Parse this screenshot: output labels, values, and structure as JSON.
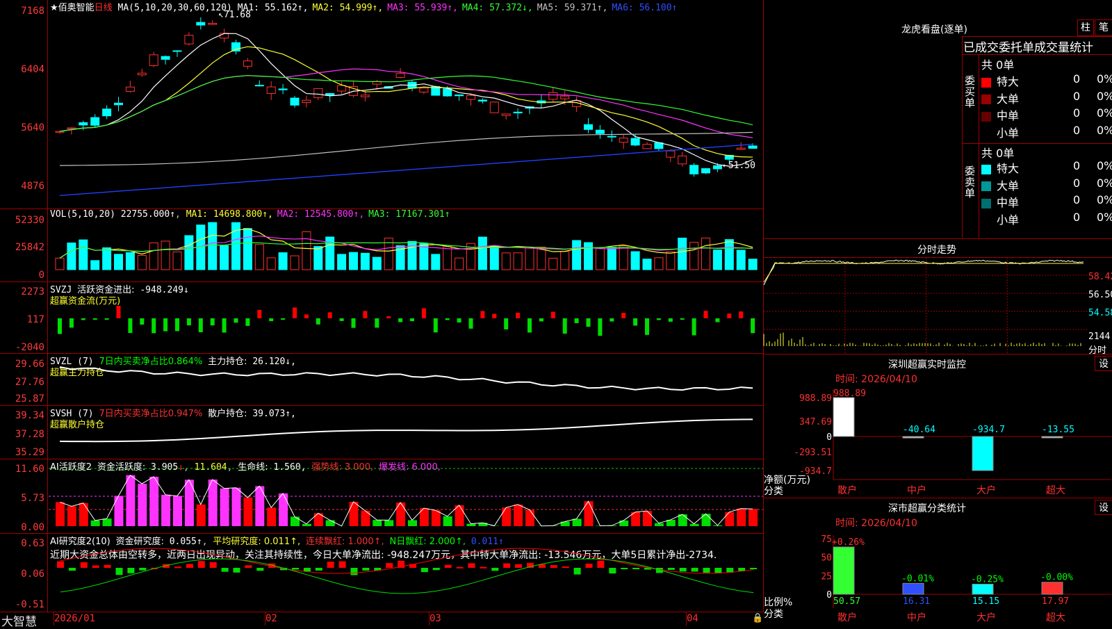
{
  "main_chart": {
    "title": "★佰奥智能",
    "period": "日线",
    "ma_header": "MA(5,10,20,30,60,120)",
    "ma": [
      {
        "label": "MA1:",
        "value": "55.162↑",
        "color": "#ffffff"
      },
      {
        "label": "MA2:",
        "value": "54.999↑",
        "color": "#ffff33"
      },
      {
        "label": "MA3:",
        "value": "55.939↑",
        "color": "#ff33ff"
      },
      {
        "label": "MA4:",
        "value": "57.372↓",
        "color": "#33ff33"
      },
      {
        "label": "MA5:",
        "value": "59.371↑",
        "color": "#c0c0c0"
      },
      {
        "label": "MA6:",
        "value": "56.100↑",
        "color": "#3050ff"
      }
    ],
    "y_ticks": [
      "7168",
      "6404",
      "5640",
      "4876"
    ],
    "high_mark": "71.68",
    "low_mark": "51.50"
  },
  "vol": {
    "header": "VOL(5,10,20)",
    "value": "22755.000↑",
    "ma": [
      {
        "label": "MA1:",
        "value": "14698.800↑",
        "color": "#ffff33"
      },
      {
        "label": "MA2:",
        "value": "12545.800↑",
        "color": "#ff33ff"
      },
      {
        "label": "MA3:",
        "value": "17167.301↑",
        "color": "#33ff33"
      }
    ],
    "y_ticks": [
      "52330",
      "25842",
      "0"
    ]
  },
  "svzj": {
    "header": "SVZJ",
    "label": "活跃资金进出:",
    "value": "-948.249↓",
    "sub": "超赢资金流(万元)",
    "y_ticks": [
      "2273",
      "117",
      "-2040"
    ]
  },
  "svzl": {
    "header": "SVZL (7)",
    "ratio": "7日内买卖净占比0.864%",
    "label": "主力持仓:",
    "value": "26.120↓,",
    "sub": "超赢主力持仓",
    "y_ticks": [
      "29.66",
      "27.76",
      "25.87"
    ]
  },
  "svsh": {
    "header": "SVSH (7)",
    "ratio": "7日内买卖净占比0.947%",
    "label": "散户持仓:",
    "value": "39.073↑,",
    "sub": "超赢散户持仓",
    "y_ticks": [
      "39.34",
      "37.28",
      "35.29"
    ]
  },
  "ai_active": {
    "header": "AI活跃度2",
    "label": "资金活跃度:",
    "value": "3.905",
    "v2": "11.604",
    "life_label": "生命线:",
    "life": "1.560,",
    "strong": "强势线: 3.000,",
    "burst": "爆发线: 6.000,",
    "y_ticks": [
      "11.60",
      "5.73",
      "0.00"
    ]
  },
  "ai_research": {
    "header": "AI研究度2(10)",
    "label": "资金研究度:",
    "value": "0.055↑",
    "avg": "平均研究度: 0.011↑,",
    "red": "连续飘红: 1.000↑,",
    "nred": "N日飘红: 2.000↑,",
    "last": "0.011↑",
    "summary": "近期大资金总体由空转多，近两日出现异动，关注其持续性，今日大单净流出: -948.247万元，其中特大单净流出: -13.546万元，大单5日累计净出-2734.",
    "y_ticks": [
      "0.63",
      "0.06",
      "-0.51"
    ]
  },
  "x_axis": {
    "brand": "大智慧",
    "labels": [
      "2026/01",
      "02",
      "03",
      "04"
    ]
  },
  "dragon": {
    "title": "龙虎看盘(逐单)",
    "btn_bar": "柱",
    "btn_pen": "笔",
    "sub_title": "已成交委托单成交量统计",
    "buy_side": "委买单",
    "sell_side": "委卖单",
    "buy_total": "共 0单",
    "sell_total": "共 0单",
    "buy_rows": [
      {
        "label": "特大",
        "count": "0",
        "pct": "0%",
        "color": "#ff0000"
      },
      {
        "label": "大单",
        "count": "0",
        "pct": "0%",
        "color": "#990000"
      },
      {
        "label": "中单",
        "count": "0",
        "pct": "0%",
        "color": "#660000"
      },
      {
        "label": "小单",
        "count": "0",
        "pct": "0%",
        "color": "#000000"
      }
    ],
    "sell_rows": [
      {
        "label": "特大",
        "count": "0",
        "pct": "0%",
        "color": "#00ffff"
      },
      {
        "label": "大单",
        "count": "0",
        "pct": "0%",
        "color": "#009999"
      },
      {
        "label": "中单",
        "count": "0",
        "pct": "0%",
        "color": "#006f6f"
      },
      {
        "label": "小单",
        "count": "0",
        "pct": "0%",
        "color": "#000000"
      }
    ]
  },
  "intraday": {
    "title": "分时走势",
    "price_ticks": [
      "58.42",
      "56.50",
      "54.58"
    ],
    "vol_tick": "2144",
    "unit": "分时"
  },
  "sz_monitor": {
    "title": "深圳超赢实时监控",
    "btn": "设",
    "time": "时间: 2026/04/10",
    "y_ticks": [
      "988.89",
      "347.69",
      "0",
      "-293.51",
      "-934.7"
    ],
    "y_label": "净额(万元)",
    "x_label": "分类",
    "bars": [
      {
        "cat": "散户",
        "value": 988.89,
        "label": "988.89",
        "color": "#ffffff"
      },
      {
        "cat": "中户",
        "value": -40.64,
        "label": "-40.64",
        "color": "#cccccc"
      },
      {
        "cat": "大户",
        "value": -934.7,
        "label": "-934.7",
        "color": "#00ffff"
      },
      {
        "cat": "超大",
        "value": -13.55,
        "label": "-13.55",
        "color": "#cccccc"
      }
    ]
  },
  "sz_class": {
    "title": "深市超赢分类统计",
    "btn": "设",
    "time": "时间: 2026/04/10",
    "y_ticks": [
      "75",
      "50",
      "25",
      "0"
    ],
    "y_label": "比例%",
    "x_label": "分类",
    "bars": [
      {
        "cat": "散户",
        "value": 50.57,
        "label": "50.57",
        "delta": "+0.26%",
        "color": "#33ff33"
      },
      {
        "cat": "中户",
        "value": 16.31,
        "label": "16.31",
        "delta": "-0.01%",
        "color": "#3050ff"
      },
      {
        "cat": "大户",
        "value": 15.15,
        "label": "15.15",
        "delta": "-0.25%",
        "color": "#00ffff"
      },
      {
        "cat": "超大",
        "value": 17.97,
        "label": "17.97",
        "delta": "-0.00%",
        "color": "#ff3030"
      }
    ]
  }
}
